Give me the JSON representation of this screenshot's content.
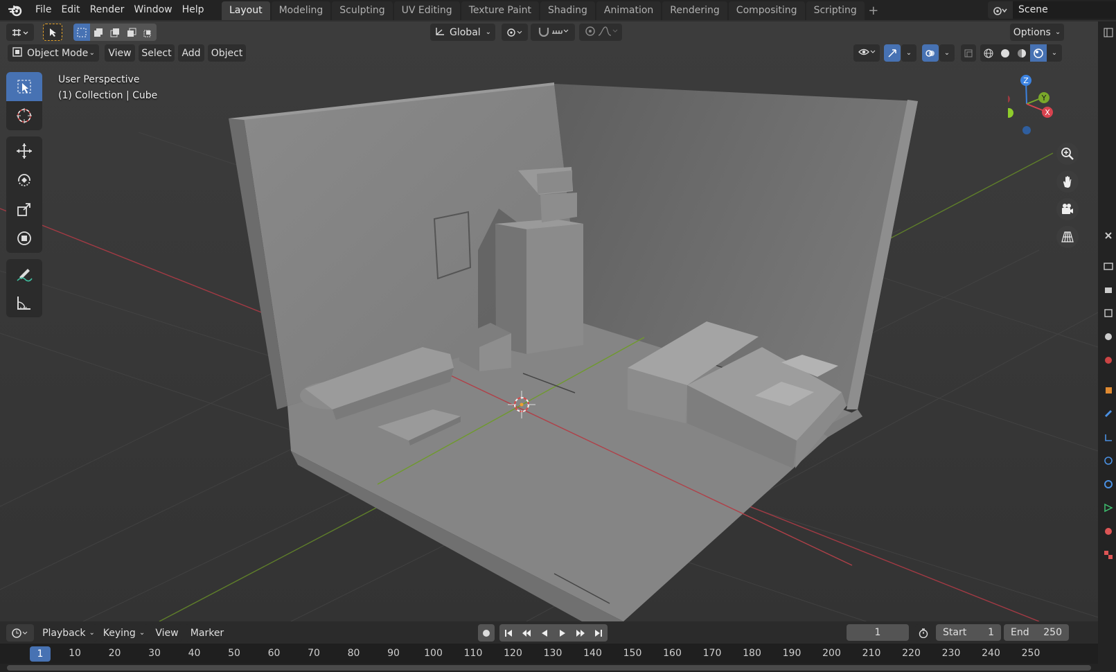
{
  "app": {
    "name": "Blender"
  },
  "menu": [
    "File",
    "Edit",
    "Render",
    "Window",
    "Help"
  ],
  "workspaces": [
    "Layout",
    "Modeling",
    "Sculpting",
    "UV Editing",
    "Texture Paint",
    "Shading",
    "Animation",
    "Rendering",
    "Compositing",
    "Scripting"
  ],
  "active_workspace": "Layout",
  "scene": {
    "name": "Scene"
  },
  "header": {
    "transform_orientation": "Global",
    "options_label": "Options",
    "mode": "Object Mode",
    "view_menu": [
      "View",
      "Select",
      "Add",
      "Object"
    ]
  },
  "viewport": {
    "perspective_label": "User Perspective",
    "collection_label": "(1) Collection | Cube",
    "axes": {
      "x": "X",
      "y": "Y",
      "z": "Z"
    }
  },
  "timeline": {
    "menus": [
      "Playback",
      "Keying",
      "View",
      "Marker"
    ],
    "current_frame": "1",
    "start_label": "Start",
    "start_value": "1",
    "end_label": "End",
    "end_value": "250",
    "ruler_labels": [
      "1",
      "10",
      "20",
      "30",
      "40",
      "50",
      "60",
      "70",
      "80",
      "90",
      "100",
      "110",
      "120",
      "130",
      "140",
      "150",
      "160",
      "170",
      "180",
      "190",
      "200",
      "210",
      "220",
      "230",
      "240",
      "250"
    ]
  },
  "colors": {
    "accent": "#4772b3",
    "x_axis": "#d8434f",
    "y_axis": "#7aa82a",
    "z_axis": "#3b82e0"
  }
}
